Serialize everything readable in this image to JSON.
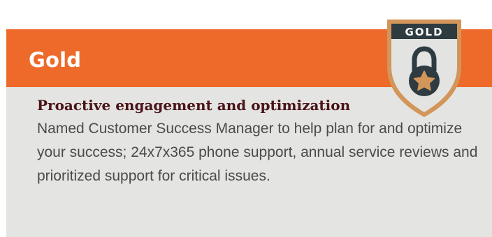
{
  "tier": {
    "title": "Gold",
    "badge_label": "GOLD",
    "heading": "Proactive engagement and optimization",
    "description": "Named Customer Success Manager to help plan for and optimize your success; 24x7x365 phone support, annual service reviews and prioritized support for critical issues."
  },
  "icons": {
    "badge": "gold-shield-lock-star-icon"
  },
  "colors": {
    "header": "#ee6a2a",
    "body_background": "#e4e4e2",
    "heading_text": "#4a1418",
    "body_text": "#4a4a4a",
    "badge_fill": "#2e3b41",
    "badge_rim": "#d2955a"
  }
}
